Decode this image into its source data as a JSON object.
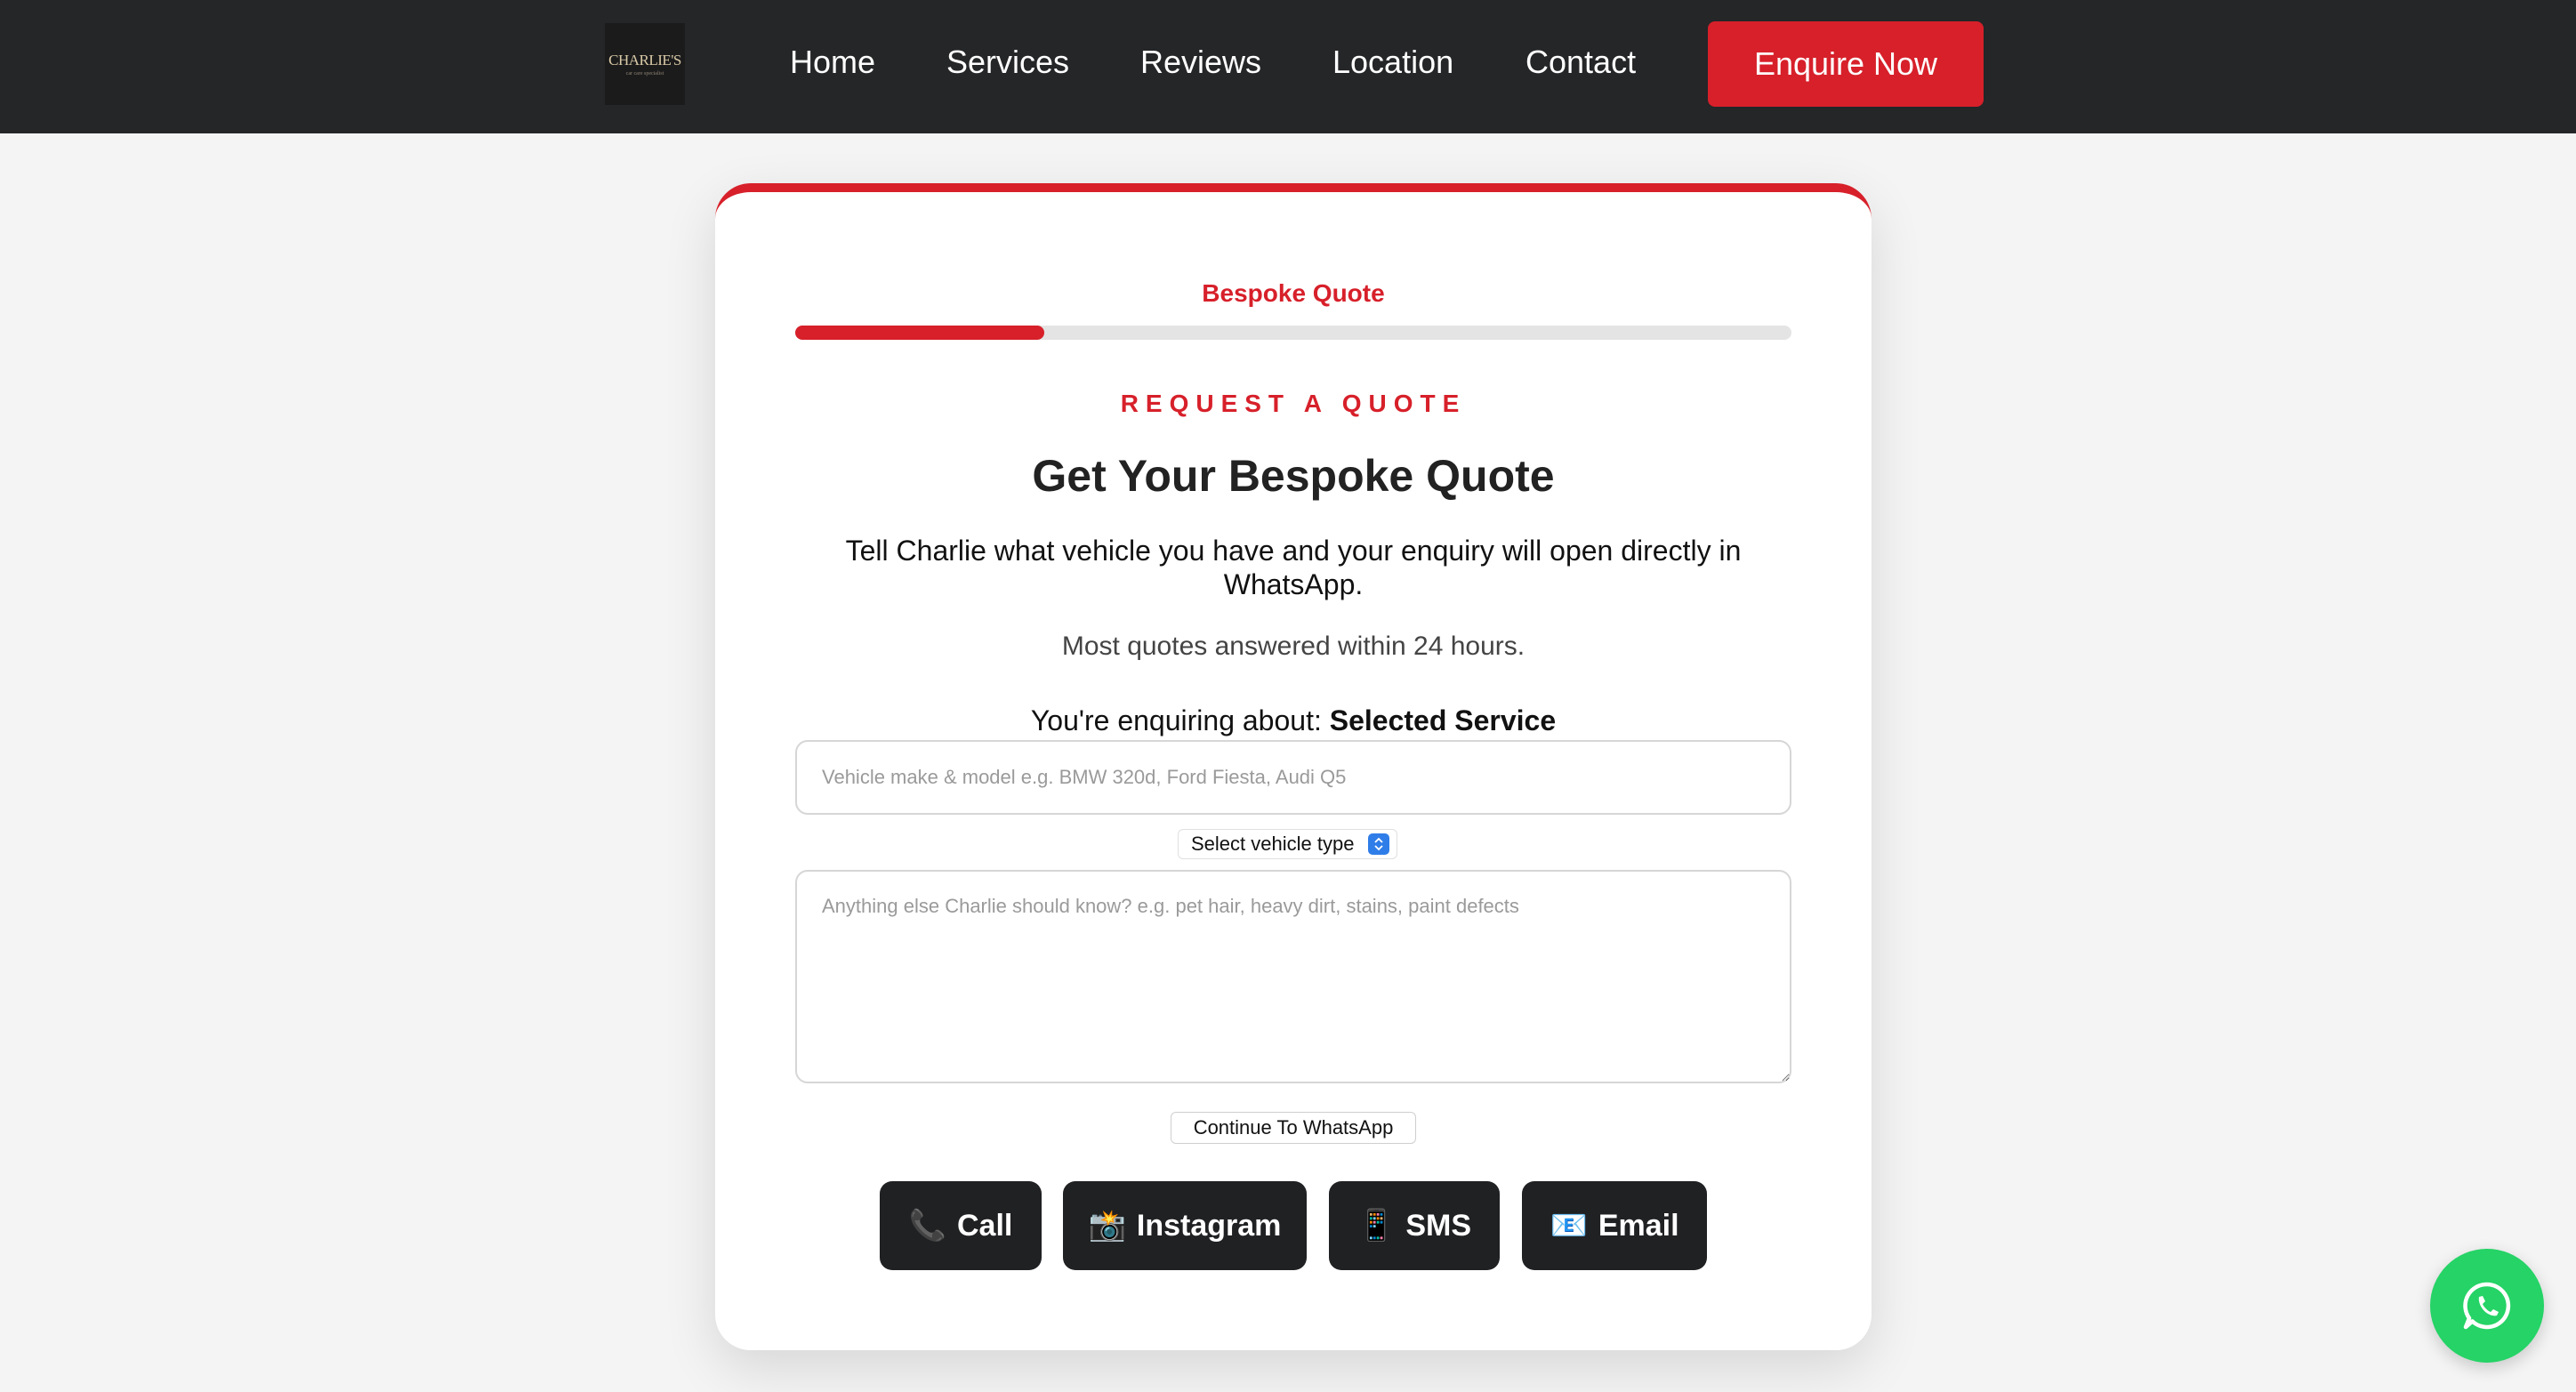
{
  "nav": {
    "logo_text": "CHARLIE'S",
    "logo_subtext": "car care specialist",
    "links": [
      "Home",
      "Services",
      "Reviews",
      "Location",
      "Contact"
    ],
    "cta_label": "Enquire Now"
  },
  "form": {
    "step_label": "Bespoke Quote",
    "progress": 0.25,
    "eyebrow": "REQUEST A QUOTE",
    "title": "Get Your Bespoke Quote",
    "description": "Tell Charlie what vehicle you have and your enquiry will open directly in WhatsApp.",
    "note": "Most quotes answered within 24 hours.",
    "enquiring_prefix": "You're enquiring about: ",
    "enquiring_service": "Selected Service",
    "vehicle_placeholder": "Vehicle make & model e.g. BMW 320d, Ford Fiesta, Audi Q5",
    "vehicle_value": "",
    "vehicle_type_selected": "Select vehicle type",
    "notes_placeholder": "Anything else Charlie should know? e.g. pet hair, heavy dirt, stains, paint defects",
    "notes_value": "",
    "continue_label": "Continue To WhatsApp"
  },
  "contact_buttons": [
    {
      "icon": "📞",
      "icon_name": "phone-icon",
      "label": "Call"
    },
    {
      "icon": "📸",
      "icon_name": "camera-icon",
      "label": "Instagram"
    },
    {
      "icon": "📱",
      "icon_name": "mobile-phone-icon",
      "label": "SMS"
    },
    {
      "icon": "📧",
      "icon_name": "email-icon",
      "label": "Email"
    }
  ],
  "colors": {
    "accent": "#d7202a",
    "nav_bg": "#252628",
    "dark_button": "#202123",
    "whatsapp": "#25d366"
  }
}
